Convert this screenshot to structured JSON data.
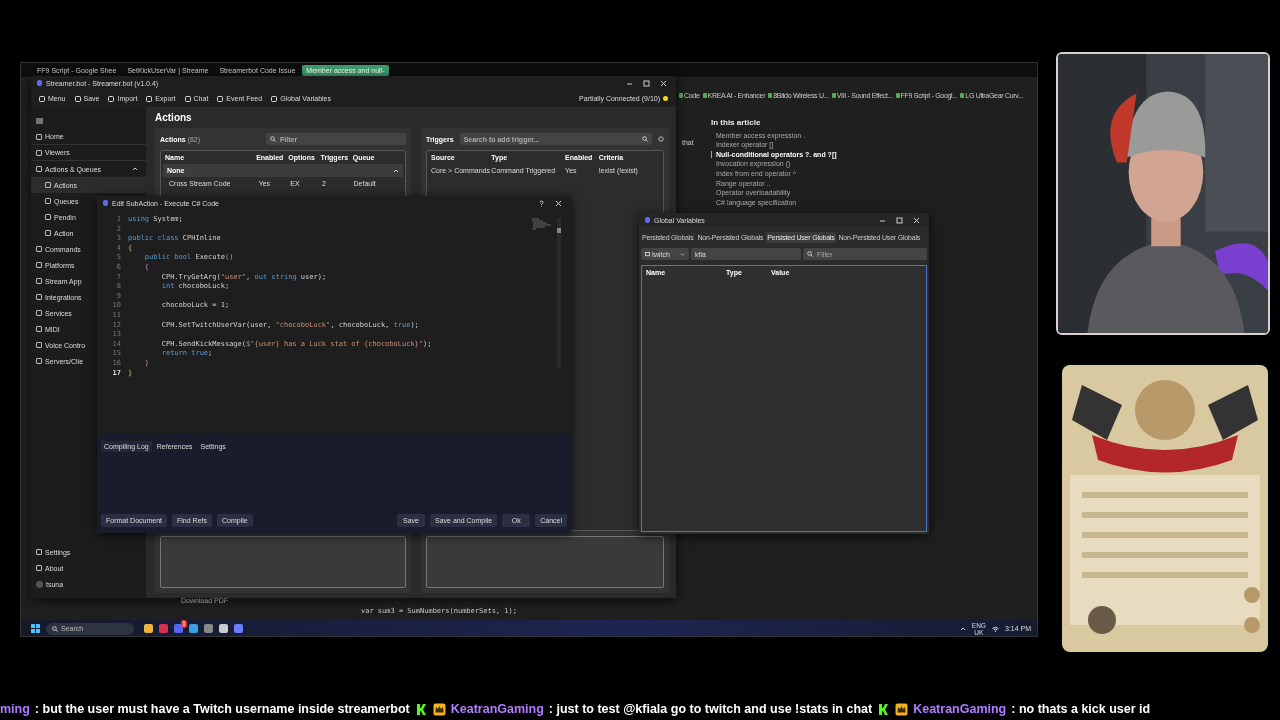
{
  "browser": {
    "tabs": [
      {
        "label": "FF9 Script - Google Shee",
        "selected": false
      },
      {
        "label": "SetKickUserVar | Streame",
        "selected": false
      },
      {
        "label": "Streamerbot Code Issue",
        "selected": false
      },
      {
        "label": "Member access and null-",
        "selected": true
      }
    ],
    "bookmarks": [
      "Code",
      "KREA AI - Enhancer",
      "8Bitdo Wireless U...",
      "VIII - Sound Effect...",
      "FF9 Script - Googl...",
      "LG UltraGear Curv..."
    ],
    "article_fragment": "that",
    "toc": {
      "title": "In this article",
      "items": [
        {
          "label": "Member access expression .",
          "selected": false
        },
        {
          "label": "Indexer operator []",
          "selected": false
        },
        {
          "label": "Null-conditional operators ?. and ?[]",
          "selected": true
        },
        {
          "label": "Invocation expression ()",
          "selected": false
        },
        {
          "label": "Index from end operator ^",
          "selected": false
        },
        {
          "label": "Range operator ..",
          "selected": false
        },
        {
          "label": "Operator overloadability",
          "selected": false
        },
        {
          "label": "C# language specification",
          "selected": false
        }
      ]
    },
    "download": "Download PDF",
    "code_snippet": "var sum3 = SumNumbers(numberSets, 1);"
  },
  "app": {
    "title": "Streamer.bot - Streamer.bot (v1.0.4)",
    "toolbar": [
      "Menu",
      "Save",
      "Import",
      "Export",
      "Chat",
      "Event Feed",
      "Global Variables"
    ],
    "connection": "Partially Connected (9/10)",
    "sidebar": {
      "items": [
        {
          "label": "Home",
          "selected": false
        },
        {
          "label": "Viewers",
          "selected": false
        },
        {
          "label": "Actions & Queues",
          "selected": false,
          "expanded": true,
          "children": [
            {
              "label": "Actions",
              "selected": true
            },
            {
              "label": "Queues",
              "selected": false
            },
            {
              "label": "Pendin",
              "selected": false
            },
            {
              "label": "Action",
              "selected": false
            }
          ]
        },
        {
          "label": "Commands",
          "selected": false
        },
        {
          "label": "Platforms",
          "selected": false
        },
        {
          "label": "Stream App",
          "selected": false
        },
        {
          "label": "Integrations",
          "selected": false
        },
        {
          "label": "Services",
          "selected": false
        },
        {
          "label": "MIDI",
          "selected": false
        },
        {
          "label": "Voice Contro",
          "selected": false
        },
        {
          "label": "Servers/Clie",
          "selected": false
        }
      ],
      "footer": [
        "Settings",
        "About"
      ],
      "user": "tsuna"
    },
    "page_title": "Actions",
    "actions": {
      "title": "Actions",
      "count": "(82)",
      "filter_placeholder": "Filter",
      "columns": [
        "Name",
        "Enabled",
        "Options",
        "Triggers",
        "Queue"
      ],
      "groups": [
        {
          "name": "None",
          "expanded": true,
          "rows": [
            [
              "Cross Stream Code",
              "Yes",
              "EX",
              "2",
              "Default"
            ]
          ]
        }
      ]
    },
    "triggers": {
      "title": "Triggers",
      "search_placeholder": "Search to add trigger...",
      "columns": [
        "Source",
        "Type",
        "Enabled",
        "Criteria"
      ],
      "rows": [
        [
          "Core > Commands",
          "Command Triggered",
          "Yes",
          "!exist (!exist)"
        ]
      ]
    }
  },
  "editor": {
    "title": "Edit SubAction - Execute C# Code",
    "lines": [
      {
        "number": "1",
        "current": false,
        "tokens": [
          {
            "t": "using",
            "kind": "kw"
          },
          {
            "t": " System;",
            "kind": "plain"
          }
        ]
      },
      {
        "number": "2",
        "current": false
      },
      {
        "number": "3",
        "current": false,
        "tokens": [
          {
            "t": "public class",
            "kind": "kw"
          },
          {
            "t": " CPHInline",
            "kind": "plain"
          }
        ]
      },
      {
        "number": "4",
        "current": false,
        "tokens": [
          {
            "t": "{",
            "kind": "brace"
          }
        ]
      },
      {
        "number": "5",
        "current": false,
        "tokens": [
          {
            "t": "    public bool",
            "kind": "kw"
          },
          {
            "t": " Execute",
            "kind": "plain"
          },
          {
            "t": "()",
            "kind": "paren"
          }
        ]
      },
      {
        "number": "6",
        "current": false,
        "tokens": [
          {
            "t": "    {",
            "kind": "paren"
          }
        ]
      },
      {
        "number": "7",
        "current": false,
        "tokens": [
          {
            "t": "        CPH.TryGetArg(",
            "kind": "plain"
          },
          {
            "t": "\"user\"",
            "kind": "str"
          },
          {
            "t": ", ",
            "kind": "plain"
          },
          {
            "t": "out string",
            "kind": "kw"
          },
          {
            "t": " user);",
            "kind": "plain"
          }
        ]
      },
      {
        "number": "8",
        "current": false,
        "tokens": [
          {
            "t": "        int",
            "kind": "kw"
          },
          {
            "t": " chocoboLuck;",
            "kind": "plain"
          }
        ]
      },
      {
        "number": "9",
        "current": false
      },
      {
        "number": "10",
        "current": false,
        "tokens": [
          {
            "t": "        chocoboLuck = 1;",
            "kind": "plain"
          }
        ]
      },
      {
        "number": "11",
        "current": false
      },
      {
        "number": "12",
        "current": false,
        "tokens": [
          {
            "t": "        CPH.SetTwitchUserVar(user, ",
            "kind": "plain"
          },
          {
            "t": "\"chocoboLuck\"",
            "kind": "str"
          },
          {
            "t": ", chocoboLuck, ",
            "kind": "plain"
          },
          {
            "t": "true",
            "kind": "kw"
          },
          {
            "t": ");",
            "kind": "plain"
          }
        ]
      },
      {
        "number": "13",
        "current": false
      },
      {
        "number": "14",
        "current": false,
        "tokens": [
          {
            "t": "        CPH.SendKickMessage(",
            "kind": "plain"
          },
          {
            "t": "$\"{user} has a Luck stat of {chocoboLuck}\"",
            "kind": "str"
          },
          {
            "t": ");",
            "kind": "plain"
          }
        ]
      },
      {
        "number": "15",
        "current": false,
        "tokens": [
          {
            "t": "        return true",
            "kind": "kw"
          },
          {
            "t": ";",
            "kind": "plain"
          }
        ]
      },
      {
        "number": "16",
        "current": false,
        "tokens": [
          {
            "t": "    }",
            "kind": "paren"
          }
        ]
      },
      {
        "number": "17",
        "current": true,
        "tokens": [
          {
            "t": "}",
            "kind": "brace"
          }
        ]
      }
    ],
    "tabs": [
      {
        "label": "Compiling Log",
        "selected": true
      },
      {
        "label": "References",
        "selected": false
      },
      {
        "label": "Settings",
        "selected": false
      }
    ],
    "left_buttons": [
      "Format Document",
      "Find Refs",
      "Compile"
    ],
    "right_buttons": [
      "Save",
      "Save and Compile",
      "Ok",
      "Cancel"
    ]
  },
  "globals": {
    "title": "Global Variables",
    "tabs": [
      {
        "label": "Persisted Globals",
        "selected": false
      },
      {
        "label": "Non-Persisted Globals",
        "selected": false
      },
      {
        "label": "Persisted User Globals",
        "selected": true
      },
      {
        "label": "Non-Persisted User Globals",
        "selected": false
      }
    ],
    "platform": "twitch",
    "user": "kfia",
    "filter_placeholder": "Filter",
    "columns": [
      "Name",
      "Type",
      "Value"
    ]
  },
  "taskbar": {
    "search_placeholder": "Search",
    "notification_badge": "1",
    "tray": [
      "ENG",
      "UK"
    ],
    "time": "3:14 PM"
  },
  "ticker": [
    {
      "user": "ming",
      "text": ": but the user must have a Twitch username inside streamerbot",
      "badges": false
    },
    {
      "user": "KeatranGaming",
      "text": ": just to test @kfiala go to twitch and use !stats in chat",
      "badges": true
    },
    {
      "user": "KeatranGaming",
      "text": ": no thats a kick user id",
      "badges": true
    }
  ]
}
